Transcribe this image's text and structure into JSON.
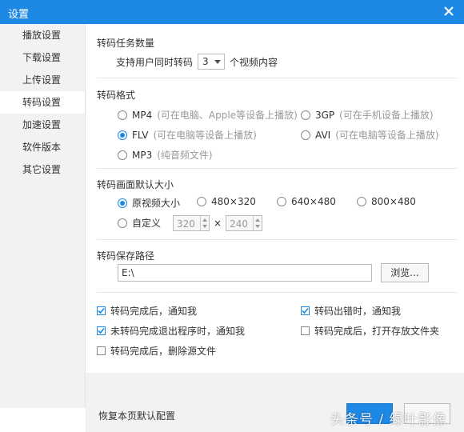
{
  "window": {
    "title": "设置"
  },
  "sidebar": {
    "items": [
      {
        "label": "播放设置"
      },
      {
        "label": "下载设置"
      },
      {
        "label": "上传设置"
      },
      {
        "label": "转码设置"
      },
      {
        "label": "加速设置"
      },
      {
        "label": "软件版本"
      },
      {
        "label": "其它设置"
      }
    ],
    "active_index": 3
  },
  "tasks": {
    "title": "转码任务数量",
    "prefix": "支持用户同时转码",
    "value": "3",
    "suffix": "个视频内容"
  },
  "format": {
    "title": "转码格式",
    "options": [
      {
        "label": "MP4",
        "hint": "(可在电脑、Apple等设备上播放)",
        "selected": false
      },
      {
        "label": "3GP",
        "hint": "(可在手机设备上播放)",
        "selected": false
      },
      {
        "label": "FLV",
        "hint": "(可在电脑等设备上播放)",
        "selected": true
      },
      {
        "label": "AVI",
        "hint": "(可在电脑等设备上播放)",
        "selected": false
      },
      {
        "label": "MP3",
        "hint": "(纯音频文件)",
        "selected": false
      }
    ]
  },
  "size": {
    "title": "转码画面默认大小",
    "options": [
      {
        "label": "原视频大小",
        "selected": true
      },
      {
        "label": "480×320",
        "selected": false
      },
      {
        "label": "640×480",
        "selected": false
      },
      {
        "label": "800×480",
        "selected": false
      }
    ],
    "custom_label": "自定义",
    "custom_width": "320",
    "custom_height": "240",
    "times": "×"
  },
  "path": {
    "title": "转码保存路径",
    "value": "E:\\",
    "browse_label": "浏览..."
  },
  "notify": {
    "options": [
      {
        "label": "转码完成后，通知我",
        "checked": true
      },
      {
        "label": "转码出错时，通知我",
        "checked": true
      },
      {
        "label": "未转码完成退出程序时，通知我",
        "checked": true
      },
      {
        "label": "转码完成后，打开存放文件夹",
        "checked": false
      },
      {
        "label": "转码完成后，删除源文件",
        "checked": false
      }
    ]
  },
  "footer": {
    "restore_label": "恢复本页默认配置",
    "watermark": "头条号 / 绿叶影像"
  },
  "colors": {
    "accent": "#1e88e5",
    "sidebar_bg": "#f2f2f2"
  }
}
